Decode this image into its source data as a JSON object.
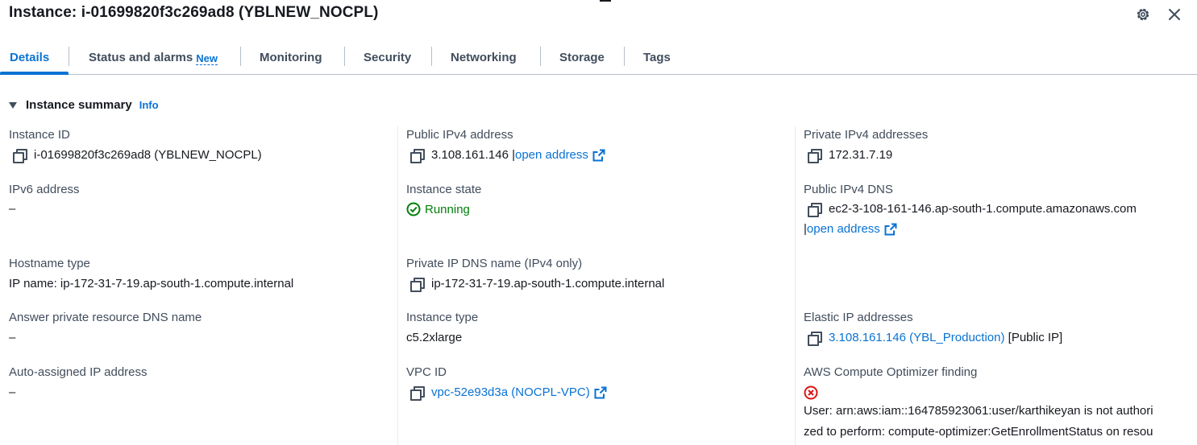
{
  "header": {
    "title": "Instance: i-01699820f3c269ad8 (YBLNEW_NOCPL)"
  },
  "tabs": [
    {
      "label": "Details"
    },
    {
      "label": "Status and alarms",
      "badge": "New"
    },
    {
      "label": "Monitoring"
    },
    {
      "label": "Security"
    },
    {
      "label": "Networking"
    },
    {
      "label": "Storage"
    },
    {
      "label": "Tags"
    }
  ],
  "summary": {
    "title": "Instance summary",
    "info": "Info"
  },
  "fields": {
    "instance_id": {
      "label": "Instance ID",
      "value": "i-01699820f3c269ad8 (YBLNEW_NOCPL)"
    },
    "public_ipv4": {
      "label": "Public IPv4 address",
      "value": "3.108.161.146 |",
      "link": "open address"
    },
    "private_ipv4": {
      "label": "Private IPv4 addresses",
      "value": "172.31.7.19"
    },
    "ipv6": {
      "label": "IPv6 address",
      "value": "–"
    },
    "instance_state": {
      "label": "Instance state",
      "value": "Running"
    },
    "public_dns": {
      "label": "Public IPv4 DNS",
      "value": "ec2-3-108-161-146.ap-south-1.compute.amazonaws.com",
      "prefix": "|",
      "link": "open address"
    },
    "hostname_type": {
      "label": "Hostname type",
      "value": "IP name: ip-172-31-7-19.ap-south-1.compute.internal"
    },
    "private_dns": {
      "label": "Private IP DNS name (IPv4 only)",
      "value": "ip-172-31-7-19.ap-south-1.compute.internal"
    },
    "answer_dns": {
      "label": "Answer private resource DNS name",
      "value": "–"
    },
    "instance_type": {
      "label": "Instance type",
      "value": "c5.2xlarge"
    },
    "elastic_ip": {
      "label": "Elastic IP addresses",
      "link": "3.108.161.146 (YBL_Production)",
      "suffix": " [Public IP]"
    },
    "auto_ip": {
      "label": "Auto-assigned IP address",
      "value": "–"
    },
    "vpc_id": {
      "label": "VPC ID",
      "link": "vpc-52e93d3a (NOCPL-VPC)"
    },
    "optimizer": {
      "label": "AWS Compute Optimizer finding",
      "line1": "User: arn:aws:iam::164785923061:user/karthikeyan is not authori",
      "line2": "zed to perform: compute-optimizer:GetEnrollmentStatus on resou"
    }
  },
  "colors": {
    "link": "#0972d3",
    "success": "#037f0c",
    "error": "#d91515",
    "text": "#16191f",
    "label": "#414d5c"
  }
}
